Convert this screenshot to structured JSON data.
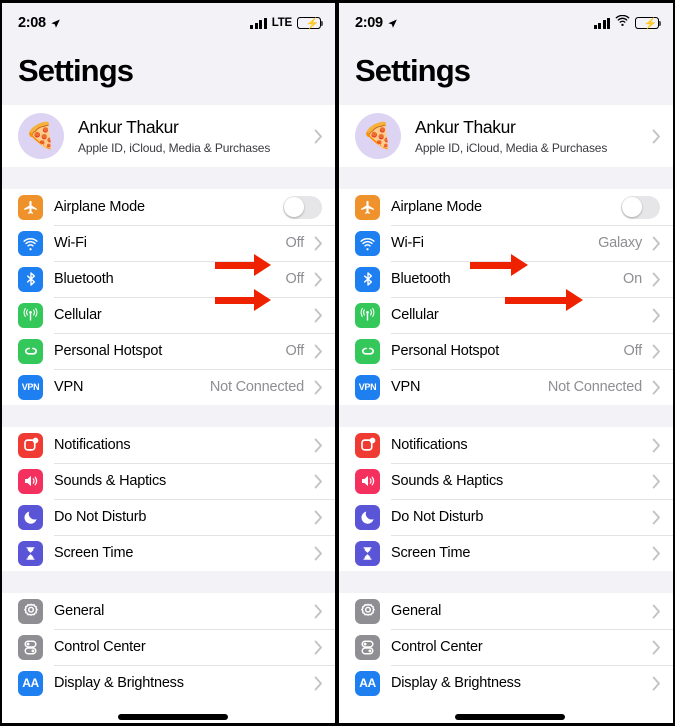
{
  "panels": [
    {
      "id": "before",
      "status": {
        "time": "2:08",
        "location_icon": "location-arrow-icon",
        "network_label": "LTE",
        "signal_icon": "cellular-bars-icon",
        "battery_icon": "battery-charging-icon"
      },
      "title": "Settings",
      "profile": {
        "name": "Ankur Thakur",
        "subtitle": "Apple ID, iCloud, Media & Purchases",
        "avatar_emoji": "🍕"
      },
      "groups": [
        {
          "rows": [
            {
              "label": "Airplane Mode",
              "icon": "airplane-icon",
              "color": "#f0922b",
              "control": "toggle",
              "toggle_on": false
            },
            {
              "label": "Wi-Fi",
              "icon": "wifi-icon",
              "color": "#1e7ff0",
              "value": "Off",
              "chevron": true,
              "arrow": true
            },
            {
              "label": "Bluetooth",
              "icon": "bluetooth-icon",
              "color": "#1e7ff0",
              "value": "Off",
              "chevron": true,
              "arrow": true
            },
            {
              "label": "Cellular",
              "icon": "cellular-antenna-icon",
              "color": "#34c759",
              "value": "",
              "chevron": true
            },
            {
              "label": "Personal Hotspot",
              "icon": "hotspot-icon",
              "color": "#34c759",
              "value": "Off",
              "chevron": true
            },
            {
              "label": "VPN",
              "icon": "vpn-icon",
              "color": "#1e7ff0",
              "value": "Not Connected",
              "chevron": true
            }
          ]
        },
        {
          "rows": [
            {
              "label": "Notifications",
              "icon": "notifications-icon",
              "color": "#f03b33",
              "value": "",
              "chevron": true
            },
            {
              "label": "Sounds & Haptics",
              "icon": "sounds-icon",
              "color": "#f4315e",
              "value": "",
              "chevron": true
            },
            {
              "label": "Do Not Disturb",
              "icon": "moon-icon",
              "color": "#5a54d6",
              "value": "",
              "chevron": true
            },
            {
              "label": "Screen Time",
              "icon": "hourglass-icon",
              "color": "#5a54d6",
              "value": "",
              "chevron": true
            }
          ]
        },
        {
          "rows": [
            {
              "label": "General",
              "icon": "gear-icon",
              "color": "#8e8e93",
              "value": "",
              "chevron": true
            },
            {
              "label": "Control Center",
              "icon": "control-center-icon",
              "color": "#8e8e93",
              "value": "",
              "chevron": true
            },
            {
              "label": "Display & Brightness",
              "icon": "display-brightness-icon",
              "color": "#1e7ff0",
              "value": "",
              "chevron": true
            }
          ]
        }
      ]
    },
    {
      "id": "after",
      "status": {
        "time": "2:09",
        "location_icon": "location-arrow-icon",
        "network_label": "",
        "signal_icon": "cellular-bars-icon",
        "wifi_icon": "wifi-status-icon",
        "battery_icon": "battery-charging-icon"
      },
      "title": "Settings",
      "profile": {
        "name": "Ankur Thakur",
        "subtitle": "Apple ID, iCloud, Media & Purchases",
        "avatar_emoji": "🍕"
      },
      "groups": [
        {
          "rows": [
            {
              "label": "Airplane Mode",
              "icon": "airplane-icon",
              "color": "#f0922b",
              "control": "toggle",
              "toggle_on": false
            },
            {
              "label": "Wi-Fi",
              "icon": "wifi-icon",
              "color": "#1e7ff0",
              "value": "Galaxy",
              "chevron": true,
              "arrow": true
            },
            {
              "label": "Bluetooth",
              "icon": "bluetooth-icon",
              "color": "#1e7ff0",
              "value": "On",
              "chevron": true,
              "arrow": true
            },
            {
              "label": "Cellular",
              "icon": "cellular-antenna-icon",
              "color": "#34c759",
              "value": "",
              "chevron": true
            },
            {
              "label": "Personal Hotspot",
              "icon": "hotspot-icon",
              "color": "#34c759",
              "value": "Off",
              "chevron": true
            },
            {
              "label": "VPN",
              "icon": "vpn-icon",
              "color": "#1e7ff0",
              "value": "Not Connected",
              "chevron": true
            }
          ]
        },
        {
          "rows": [
            {
              "label": "Notifications",
              "icon": "notifications-icon",
              "color": "#f03b33",
              "value": "",
              "chevron": true
            },
            {
              "label": "Sounds & Haptics",
              "icon": "sounds-icon",
              "color": "#f4315e",
              "value": "",
              "chevron": true
            },
            {
              "label": "Do Not Disturb",
              "icon": "moon-icon",
              "color": "#5a54d6",
              "value": "",
              "chevron": true
            },
            {
              "label": "Screen Time",
              "icon": "hourglass-icon",
              "color": "#5a54d6",
              "value": "",
              "chevron": true
            }
          ]
        },
        {
          "rows": [
            {
              "label": "General",
              "icon": "gear-icon",
              "color": "#8e8e93",
              "value": "",
              "chevron": true
            },
            {
              "label": "Control Center",
              "icon": "control-center-icon",
              "color": "#8e8e93",
              "value": "",
              "chevron": true
            },
            {
              "label": "Display & Brightness",
              "icon": "display-brightness-icon",
              "color": "#1e7ff0",
              "value": "",
              "chevron": true
            }
          ]
        }
      ]
    }
  ],
  "annotation": {
    "arrow_color": "#ee2200",
    "shape": "right-arrow"
  },
  "theme": {
    "screen_bg": "#ffffff",
    "group_gap_bg": "#f2f2f7",
    "separator": "#e3e3e6",
    "value_text": "#8e8e93",
    "chevron": "#c2c2c7"
  }
}
